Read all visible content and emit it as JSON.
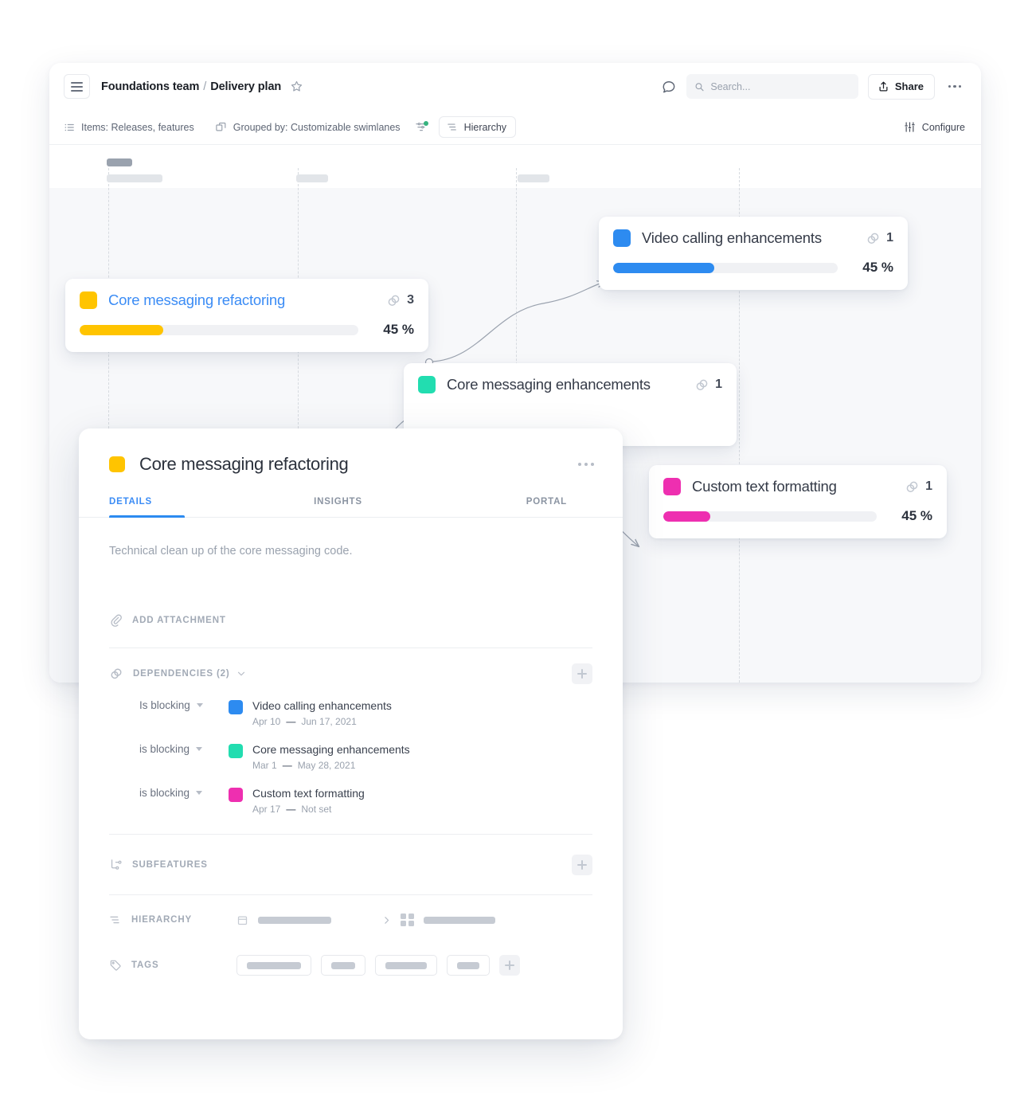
{
  "header": {
    "breadcrumb_team": "Foundations team",
    "breadcrumb_sep": "/",
    "breadcrumb_page": "Delivery plan",
    "search_placeholder": "Search...",
    "search_value": "",
    "share_label": "Share"
  },
  "toolbar": {
    "items_label": "Items: Releases, features",
    "grouped_label": "Grouped by: Customizable swimlanes",
    "hierarchy_label": "Hierarchy",
    "configure_label": "Configure"
  },
  "colors": {
    "yellow": "#FFC400",
    "blue": "#2D8BF0",
    "teal": "#22DDB0",
    "pink": "#EE2FB0",
    "link": "#3B8CF5",
    "filter_dot": "#36B37E"
  },
  "cards": [
    {
      "title": "Core messaging refactoring",
      "color": "#FFC400",
      "dependency_count": "3",
      "progress_label": "45 %",
      "progress_fill": 30,
      "has_progress": true,
      "title_is_link": true
    },
    {
      "title": "Video calling enhancements",
      "color": "#2D8BF0",
      "dependency_count": "1",
      "progress_label": "45 %",
      "progress_fill": 45,
      "has_progress": true,
      "title_is_link": false
    },
    {
      "title": "Core messaging enhancements",
      "color": "#22DDB0",
      "dependency_count": "1",
      "progress_label": "",
      "progress_fill": 0,
      "has_progress": false,
      "title_is_link": false
    },
    {
      "title": "Custom text formatting",
      "color": "#EE2FB0",
      "dependency_count": "1",
      "progress_label": "45 %",
      "progress_fill": 22,
      "has_progress": true,
      "title_is_link": false
    }
  ],
  "panel": {
    "title": "Core messaging refactoring",
    "color": "#FFC400",
    "tabs": [
      {
        "label": "DETAILS",
        "active": true
      },
      {
        "label": "INSIGHTS",
        "active": false
      },
      {
        "label": "PORTAL",
        "active": false
      }
    ],
    "description": "Technical clean up of the core messaging code.",
    "add_attachment_label": "ADD ATTACHMENT",
    "dependencies_label": "DEPENDENCIES (2)",
    "dependencies": [
      {
        "relation": "Is blocking",
        "color": "#2D8BF0",
        "name": "Video calling enhancements",
        "start": "Apr 10",
        "dash": "—",
        "end": "Jun 17, 2021"
      },
      {
        "relation": "is blocking",
        "color": "#22DDB0",
        "name": "Core messaging enhancements",
        "start": "Mar 1",
        "dash": "—",
        "end": "May 28, 2021"
      },
      {
        "relation": "is blocking",
        "color": "#EE2FB0",
        "name": "Custom text formatting",
        "start": "Apr 17",
        "dash": "—",
        "end": "Not set"
      }
    ],
    "subfeatures_label": "SUBFEATURES",
    "hierarchy_label": "HIERARCHY",
    "tags_label": "TAGS"
  }
}
